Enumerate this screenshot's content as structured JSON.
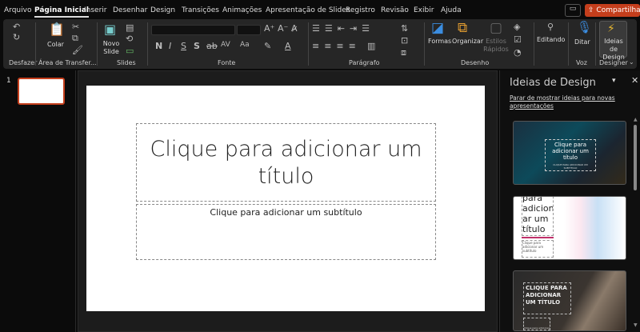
{
  "menu": {
    "tabs": [
      "Arquivo",
      "Página Inicial",
      "Inserir",
      "Desenhar",
      "Design",
      "Transições",
      "Animações",
      "Apresentação de Slides",
      "Registro",
      "Revisão",
      "Exibir",
      "Ajuda"
    ],
    "active": "Página Inicial",
    "comment_icon": "comment-icon",
    "share_label": "Compartilhar",
    "share_color": "#c43e1c"
  },
  "ribbon": {
    "groups": {
      "undo": "Desfazer",
      "clipboard": "Área de Transfer...",
      "slides": "Slides",
      "font": "Fonte",
      "paragraph": "Parágrafo",
      "drawing": "Desenho",
      "voice": "Voz",
      "designer": "Designer"
    },
    "paste": "Colar",
    "new_slide": "Novo Slide",
    "font_buttons": [
      "N",
      "I",
      "S",
      "S"
    ],
    "char_spacing": "AV",
    "case": "Aa",
    "shapes": "Formas",
    "arrange": "Organizar",
    "quick_styles": "Estilos Rápidos",
    "editing": "Editando",
    "dictate": "Ditar",
    "design_ideas": "Ideias de Design"
  },
  "thumbs": {
    "number": "1"
  },
  "slide": {
    "title_placeholder": "Clique para adicionar um título",
    "subtitle_placeholder": "Clique para adicionar um subtítulo"
  },
  "design_pane": {
    "title": "Ideias de Design",
    "stop_link": "Parar de mostrar ideias para novas apresentações",
    "cards": [
      {
        "title": "Clique para adicionar um título",
        "subtitle": "CLIQUE PARA ADICIONAR UM SUBTÍTULO"
      },
      {
        "title": "para adicion ar um título",
        "subtitle": "Clique para adicionar um subtítulo"
      },
      {
        "title": "CLIQUE PARA ADICIONAR UM TÍTULO",
        "subtitle": "Clique para adicionar um subtítulo"
      }
    ]
  }
}
